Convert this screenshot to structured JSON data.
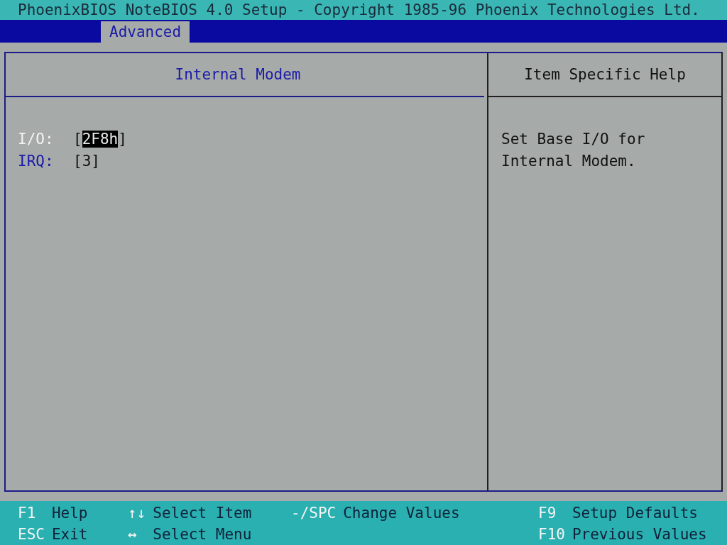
{
  "title_bar": "PhoenixBIOS NoteBIOS 4.0 Setup - Copyright 1985-96 Phoenix Technologies Ltd.",
  "tabs": [
    {
      "label": "Advanced",
      "selected": true
    }
  ],
  "panel": {
    "title": "Internal Modem",
    "settings": [
      {
        "label": "I/O:",
        "open": "[",
        "value": "2F8h",
        "close": "]",
        "selected": true
      },
      {
        "label": "IRQ:",
        "open": "[",
        "value": "3",
        "close": "]",
        "selected": false
      }
    ]
  },
  "help": {
    "title": "Item Specific Help",
    "text": "Set Base I/O for\nInternal Modem."
  },
  "footer": [
    [
      {
        "key": "F1",
        "action": "Help"
      },
      {
        "key": "ESC",
        "action": "Exit"
      }
    ],
    [
      {
        "key": "↑↓",
        "action": "Select Item"
      },
      {
        "key": "↔",
        "action": "Select Menu"
      }
    ],
    [
      {
        "key": "-/SPC",
        "action": "Change Values"
      }
    ],
    [
      {
        "key": "F9",
        "action": "Setup Defaults"
      },
      {
        "key": "F10",
        "action": "Previous Values"
      }
    ]
  ]
}
